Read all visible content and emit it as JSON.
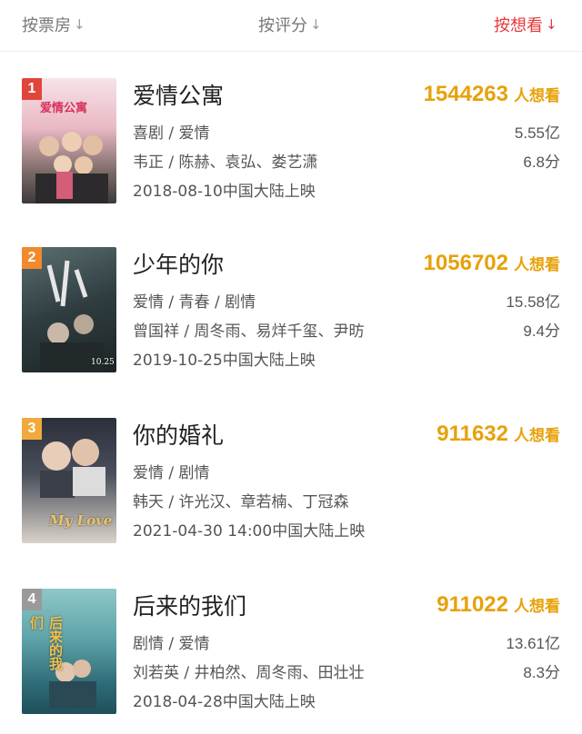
{
  "sort": {
    "by_box": "按票房",
    "by_score": "按评分",
    "by_want": "按想看",
    "arrow": "↓"
  },
  "want_suffix": "人想看",
  "movies": [
    {
      "rank": "1",
      "title": "爱情公寓",
      "want": "1544263",
      "genre": "喜剧 / 爱情",
      "cast": "韦正 / 陈赫、袁弘、娄艺潇",
      "release": "2018-08-10中国大陆上映",
      "box": "5.55亿",
      "score": "6.8分",
      "poster_text": "爱情公寓"
    },
    {
      "rank": "2",
      "title": "少年的你",
      "want": "1056702",
      "genre": "爱情 / 青春 / 剧情",
      "cast": "曾国祥 / 周冬雨、易烊千玺、尹昉",
      "release": "2019-10-25中国大陆上映",
      "box": "15.58亿",
      "score": "9.4分",
      "poster_text": "10.25"
    },
    {
      "rank": "3",
      "title": "你的婚礼",
      "want": "911632",
      "genre": "爱情 / 剧情",
      "cast": "韩天 / 许光汉、章若楠、丁冠森",
      "release": "2021-04-30 14:00中国大陆上映",
      "poster_text": "My Love"
    },
    {
      "rank": "4",
      "title": "后来的我们",
      "want": "911022",
      "genre": "剧情 / 爱情",
      "cast": "刘若英 / 井柏然、周冬雨、田壮壮",
      "release": "2018-04-28中国大陆上映",
      "box": "13.61亿",
      "score": "8.3分",
      "poster_text": "后来的我们"
    }
  ],
  "colors": {
    "accent_red": "#e5383b",
    "want_orange": "#e7a10a",
    "rank1": "#e0463b",
    "rank2": "#f08a2c",
    "rank3": "#f2a93b",
    "rank_other": "#9a9a9a"
  }
}
